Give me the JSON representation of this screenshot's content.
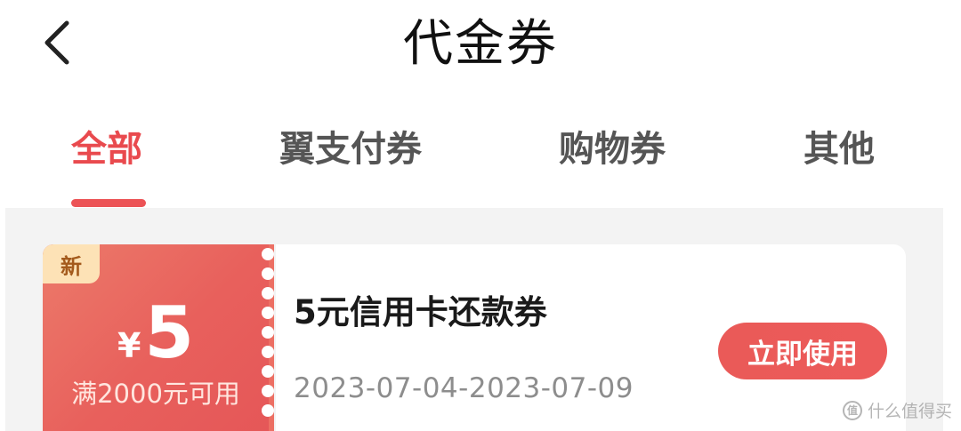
{
  "header": {
    "title": "代金券",
    "back_icon": "chevron-left-icon"
  },
  "tabs": [
    {
      "label": "全部",
      "active": true
    },
    {
      "label": "翼支付券",
      "active": false
    },
    {
      "label": "购物券",
      "active": false
    },
    {
      "label": "其他",
      "active": false
    }
  ],
  "colors": {
    "accent": "#e94a4e",
    "coupon_gradient_start": "#ec7a6a",
    "coupon_gradient_end": "#e55758",
    "badge_bg": "#fde2b6",
    "list_bg": "#f3f3f3"
  },
  "coupons": [
    {
      "badge": "新",
      "currency": "¥",
      "amount": "5",
      "condition": "满2000元可用",
      "name": "5元信用卡还款券",
      "dates": "2023-07-04-2023-07-09",
      "action_label": "立即使用"
    }
  ],
  "watermark": {
    "text": "什么值得买",
    "icon": "smzdm-logo-icon"
  }
}
